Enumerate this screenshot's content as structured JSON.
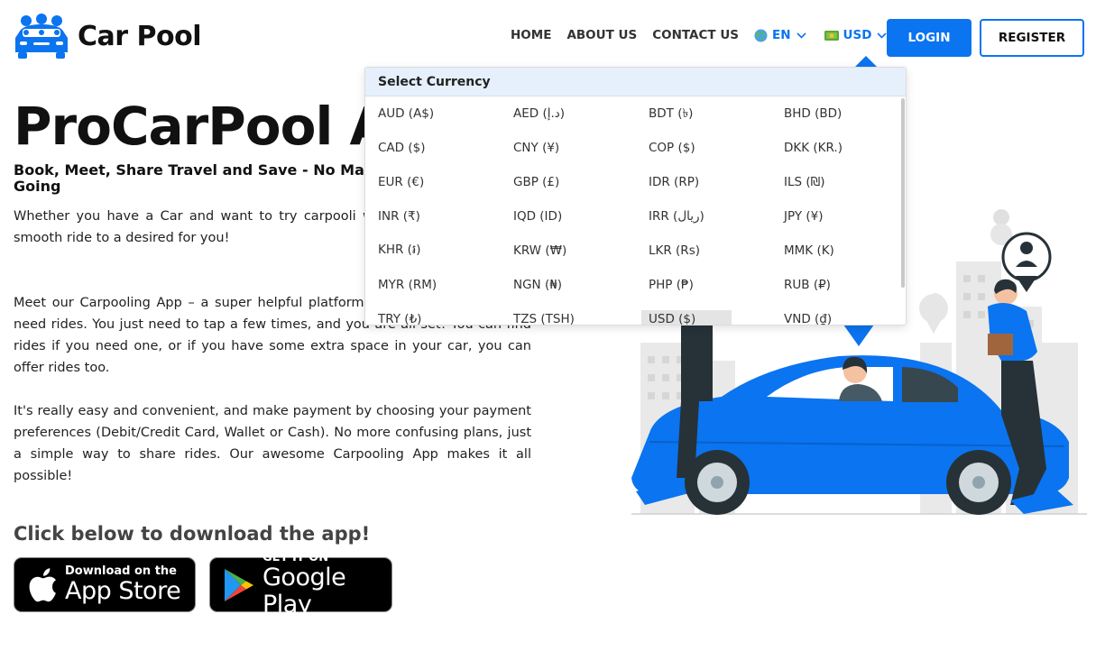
{
  "brand": {
    "name": "Car Pool",
    "logo_icon": "car-pool-logo-icon",
    "accent_color": "#0b74f0"
  },
  "nav": {
    "links": [
      "HOME",
      "ABOUT US",
      "CONTACT US"
    ],
    "language": {
      "label": "EN",
      "icon": "globe-icon"
    },
    "currency": {
      "label": "USD",
      "icon": "money-icon"
    },
    "login_label": "LOGIN",
    "register_label": "REGISTER"
  },
  "hero": {
    "title": "ProCarPool A",
    "subtitle": "Book, Meet, Share Travel and Save - No Ma\nGoing",
    "paragraphs": [
      "Whether you have a Car and want to try carpooli who needs a simple and smooth ride to a desired for you!",
      "Meet our Carpooling App – a super helpful platform owners and people who need rides. You just need to tap a few times, and you are all set! You can find rides if you need one, or if you have some extra space in your car, you can offer rides too.",
      "It's really easy and convenient, and make payment by choosing your payment preferences (Debit/Credit Card, Wallet or Cash). No more confusing plans, just a simple way to share rides. Our awesome Carpooling App makes it all possible!"
    ]
  },
  "download": {
    "title": "Click below to download the app!",
    "appstore": {
      "small": "Download on the",
      "big": "App Store",
      "icon": "apple-icon"
    },
    "googleplay": {
      "small": "GET IT ON",
      "big": "Google Play",
      "icon": "google-play-icon"
    }
  },
  "currency_dropdown": {
    "header": "Select Currency",
    "selected": "USD ($)",
    "items": [
      "AUD (A$)",
      "AED (د.إ)",
      "BDT (৳)",
      "BHD (BD)",
      "CAD ($)",
      "CNY (¥)",
      "COP ($)",
      "DKK (KR.)",
      "EUR (€)",
      "GBP (£)",
      "IDR (RP)",
      "ILS (₪)",
      "INR (₹)",
      "IQD (ID)",
      "IRR (ریال)",
      "JPY (¥)",
      "KHR (៛)",
      "KRW (₩)",
      "LKR (Rs)",
      "MMK (K)",
      "MYR (RM)",
      "NGN (₦)",
      "PHP (₱)",
      "RUB (₽)",
      "TRY (₺)",
      "TZS (TSH)",
      "USD ($)",
      "VND (₫)"
    ]
  }
}
